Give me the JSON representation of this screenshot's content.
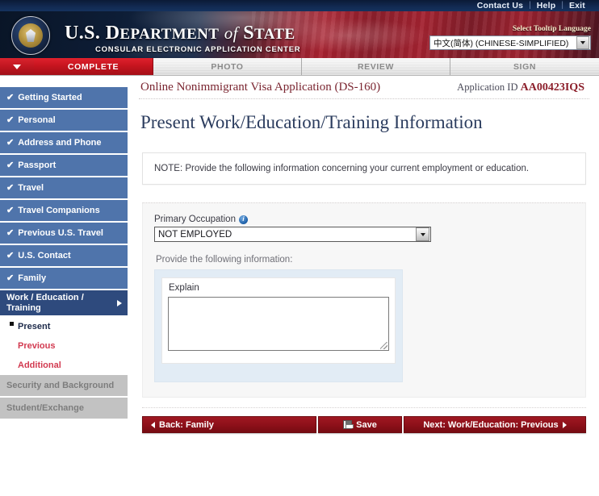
{
  "utility": {
    "links": [
      "Contact Us",
      "Help",
      "Exit"
    ],
    "separator": "|"
  },
  "banner": {
    "title_us": "U.S.",
    "title_department": "D",
    "title_department_rest": "EPARTMENT",
    "title_of": "of",
    "title_state": "S",
    "title_state_rest": "TATE",
    "subtitle": "CONSULAR ELECTRONIC APPLICATION CENTER",
    "tooltip_language_label": "Select Tooltip Language",
    "tooltip_language_value": "中文(简体) (CHINESE-SIMPLIFIED)"
  },
  "tabs": [
    {
      "label": "COMPLETE",
      "state": "active"
    },
    {
      "label": "PHOTO",
      "state": "inactive"
    },
    {
      "label": "REVIEW",
      "state": "inactive"
    },
    {
      "label": "SIGN",
      "state": "inactive"
    }
  ],
  "sidebar": {
    "items": [
      {
        "label": "Getting Started",
        "state": "complete",
        "check": "✔"
      },
      {
        "label": "Personal",
        "state": "complete",
        "check": "✔"
      },
      {
        "label": "Address and Phone",
        "state": "complete",
        "check": "✔"
      },
      {
        "label": "Passport",
        "state": "complete",
        "check": "✔"
      },
      {
        "label": "Travel",
        "state": "complete",
        "check": "✔"
      },
      {
        "label": "Travel Companions",
        "state": "complete",
        "check": "✔"
      },
      {
        "label": "Previous U.S. Travel",
        "state": "complete",
        "check": "✔"
      },
      {
        "label": "U.S. Contact",
        "state": "complete",
        "check": "✔"
      },
      {
        "label": "Family",
        "state": "complete",
        "check": "✔"
      },
      {
        "label": "Work / Education / Training",
        "state": "current",
        "check": ""
      }
    ],
    "sub_items": [
      {
        "label": "Present",
        "state": "selected"
      },
      {
        "label": "Previous",
        "state": "link"
      },
      {
        "label": "Additional",
        "state": "link"
      }
    ],
    "disabled_items": [
      {
        "label": "Security and Background",
        "state": "disabled"
      },
      {
        "label": "Student/Exchange",
        "state": "disabled"
      }
    ]
  },
  "header": {
    "app_title": "Online Nonimmigrant Visa Application (DS-160)",
    "app_id_label": "Application ID",
    "app_id_value": "AA00423IQS"
  },
  "main": {
    "page_title": "Present Work/Education/Training Information",
    "note": "NOTE: Provide the following information concerning your current employment or education.",
    "primary_occupation_label": "Primary Occupation",
    "primary_occupation_value": "NOT EMPLOYED",
    "info_icon_glyph": "i",
    "provide_text": "Provide the following information:",
    "explain_label": "Explain",
    "explain_value": ""
  },
  "footer": {
    "back_label": "Back: Family",
    "save_label": "Save",
    "next_label": "Next: Work/Education: Previous"
  },
  "colors": {
    "brand_red": "#8c1f2b",
    "brand_navy": "#2b3c5e",
    "sidebar_blue": "#4f74ab",
    "sidebar_current": "#2e4a7d",
    "sidebar_disabled": "#c2c2c2",
    "link_red": "#d23a50",
    "tab_active": "#c6151f"
  }
}
